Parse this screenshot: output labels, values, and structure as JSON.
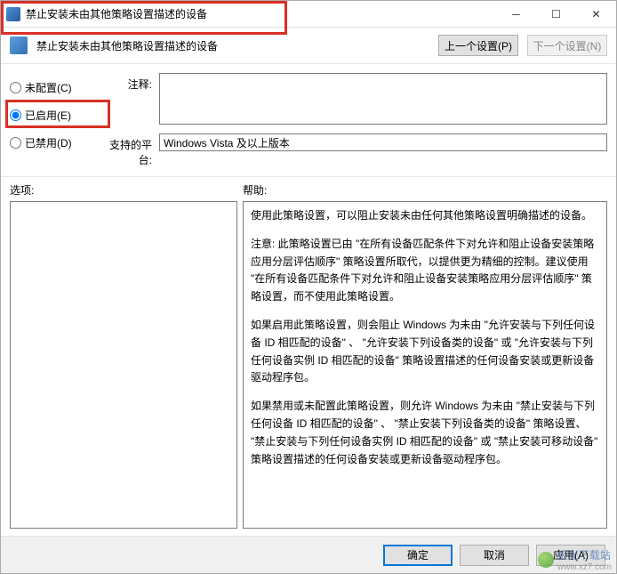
{
  "window": {
    "title": "禁止安装未由其他策略设置描述的设备"
  },
  "header": {
    "title": "禁止安装未由其他策略设置描述的设备",
    "prev_btn": "上一个设置(P)",
    "next_btn": "下一个设置(N)"
  },
  "radios": {
    "not_configured": "未配置(C)",
    "enabled": "已启用(E)",
    "disabled": "已禁用(D)",
    "selected": "enabled"
  },
  "fields": {
    "comment_label": "注释:",
    "comment_value": "",
    "platform_label": "支持的平台:",
    "platform_value": "Windows Vista 及以上版本"
  },
  "panels": {
    "options_label": "选项:",
    "help_label": "帮助:"
  },
  "help_text": {
    "p1": "使用此策略设置，可以阻止安装未由任何其他策略设置明确描述的设备。",
    "p2": "注意: 此策略设置已由 \"在所有设备匹配条件下对允许和阻止设备安装策略应用分层评估顺序\" 策略设置所取代，以提供更为精细的控制。建议使用 \"在所有设备匹配条件下对允许和阻止设备安装策略应用分层评估顺序\" 策略设置，而不使用此策略设置。",
    "p3": "如果启用此策略设置，则会阻止 Windows 为未由 \"允许安装与下列任何设备 ID 相匹配的设备\" 、 \"允许安装下列设备类的设备\" 或 \"允许安装与下列任何设备实例 ID 相匹配的设备\" 策略设置描述的任何设备安装或更新设备驱动程序包。",
    "p4": "如果禁用或未配置此策略设置，则允许 Windows 为未由 \"禁止安装与下列任何设备 ID 相匹配的设备\" 、 \"禁止安装下列设备类的设备\" 策略设置、 \"禁止安装与下列任何设备实例 ID 相匹配的设备\" 或 \"禁止安装可移动设备\" 策略设置描述的任何设备安装或更新设备驱动程序包。"
  },
  "footer": {
    "ok": "确定",
    "cancel": "取消",
    "apply": "应用(A)"
  },
  "watermark": {
    "line1": "极光下载站",
    "line2": "www.xz7.com"
  }
}
